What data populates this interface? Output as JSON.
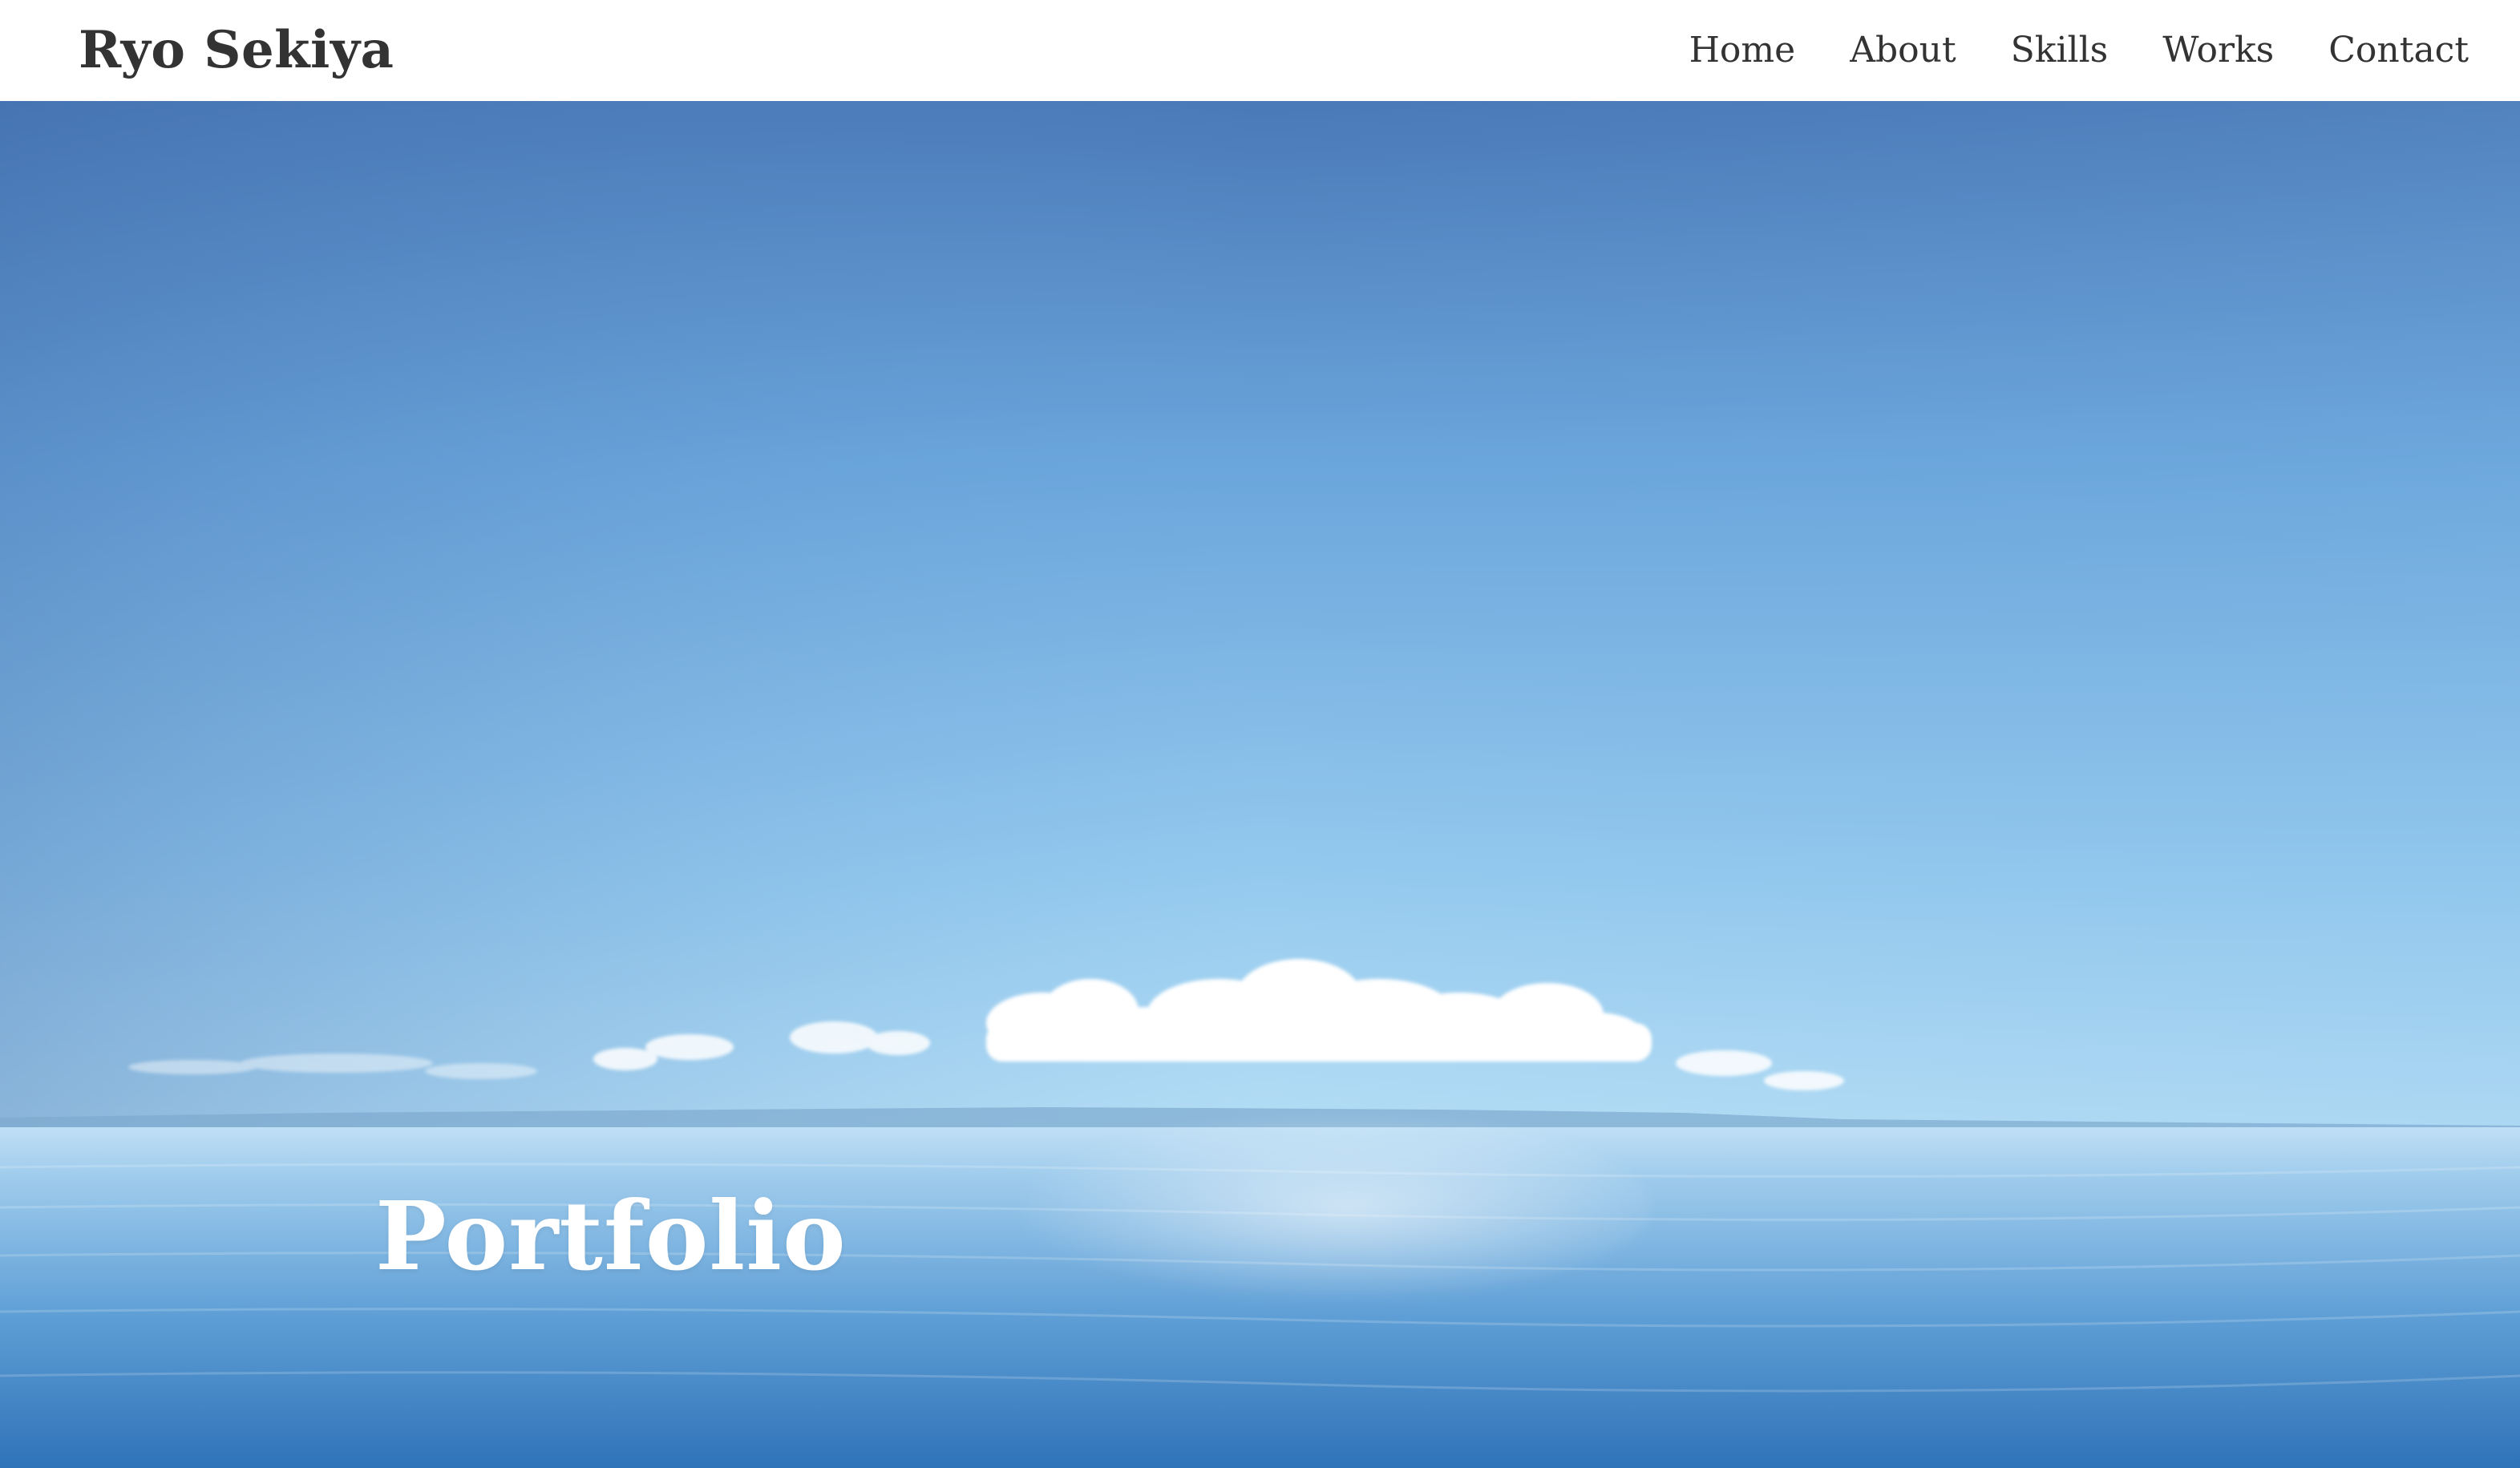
{
  "header": {
    "brand": "Ryo Sekiya",
    "nav": [
      {
        "label": "Home"
      },
      {
        "label": "About"
      },
      {
        "label": "Skills"
      },
      {
        "label": "Works"
      },
      {
        "label": "Contact"
      }
    ]
  },
  "hero": {
    "title": "Portfolio"
  },
  "colors": {
    "header_bg": "#ffffff",
    "text_dark": "#333333",
    "sky_top": "#4a7ab8",
    "sky_horizon": "#a9d6f2",
    "sea": "#3f86c6"
  }
}
